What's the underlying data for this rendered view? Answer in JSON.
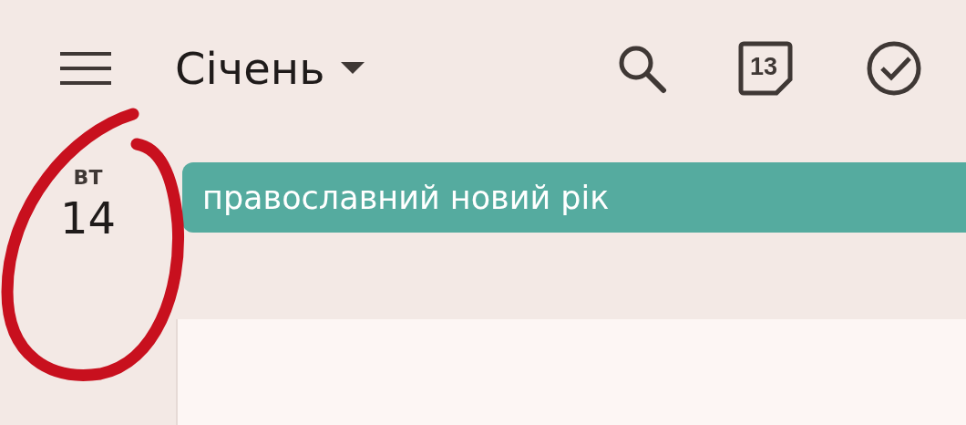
{
  "header": {
    "month": "Січень",
    "calendar_day": "13"
  },
  "day": {
    "weekday": "ВТ",
    "number": "14"
  },
  "events": [
    {
      "title": "православний новий рік",
      "color": "#55ab9f"
    }
  ]
}
